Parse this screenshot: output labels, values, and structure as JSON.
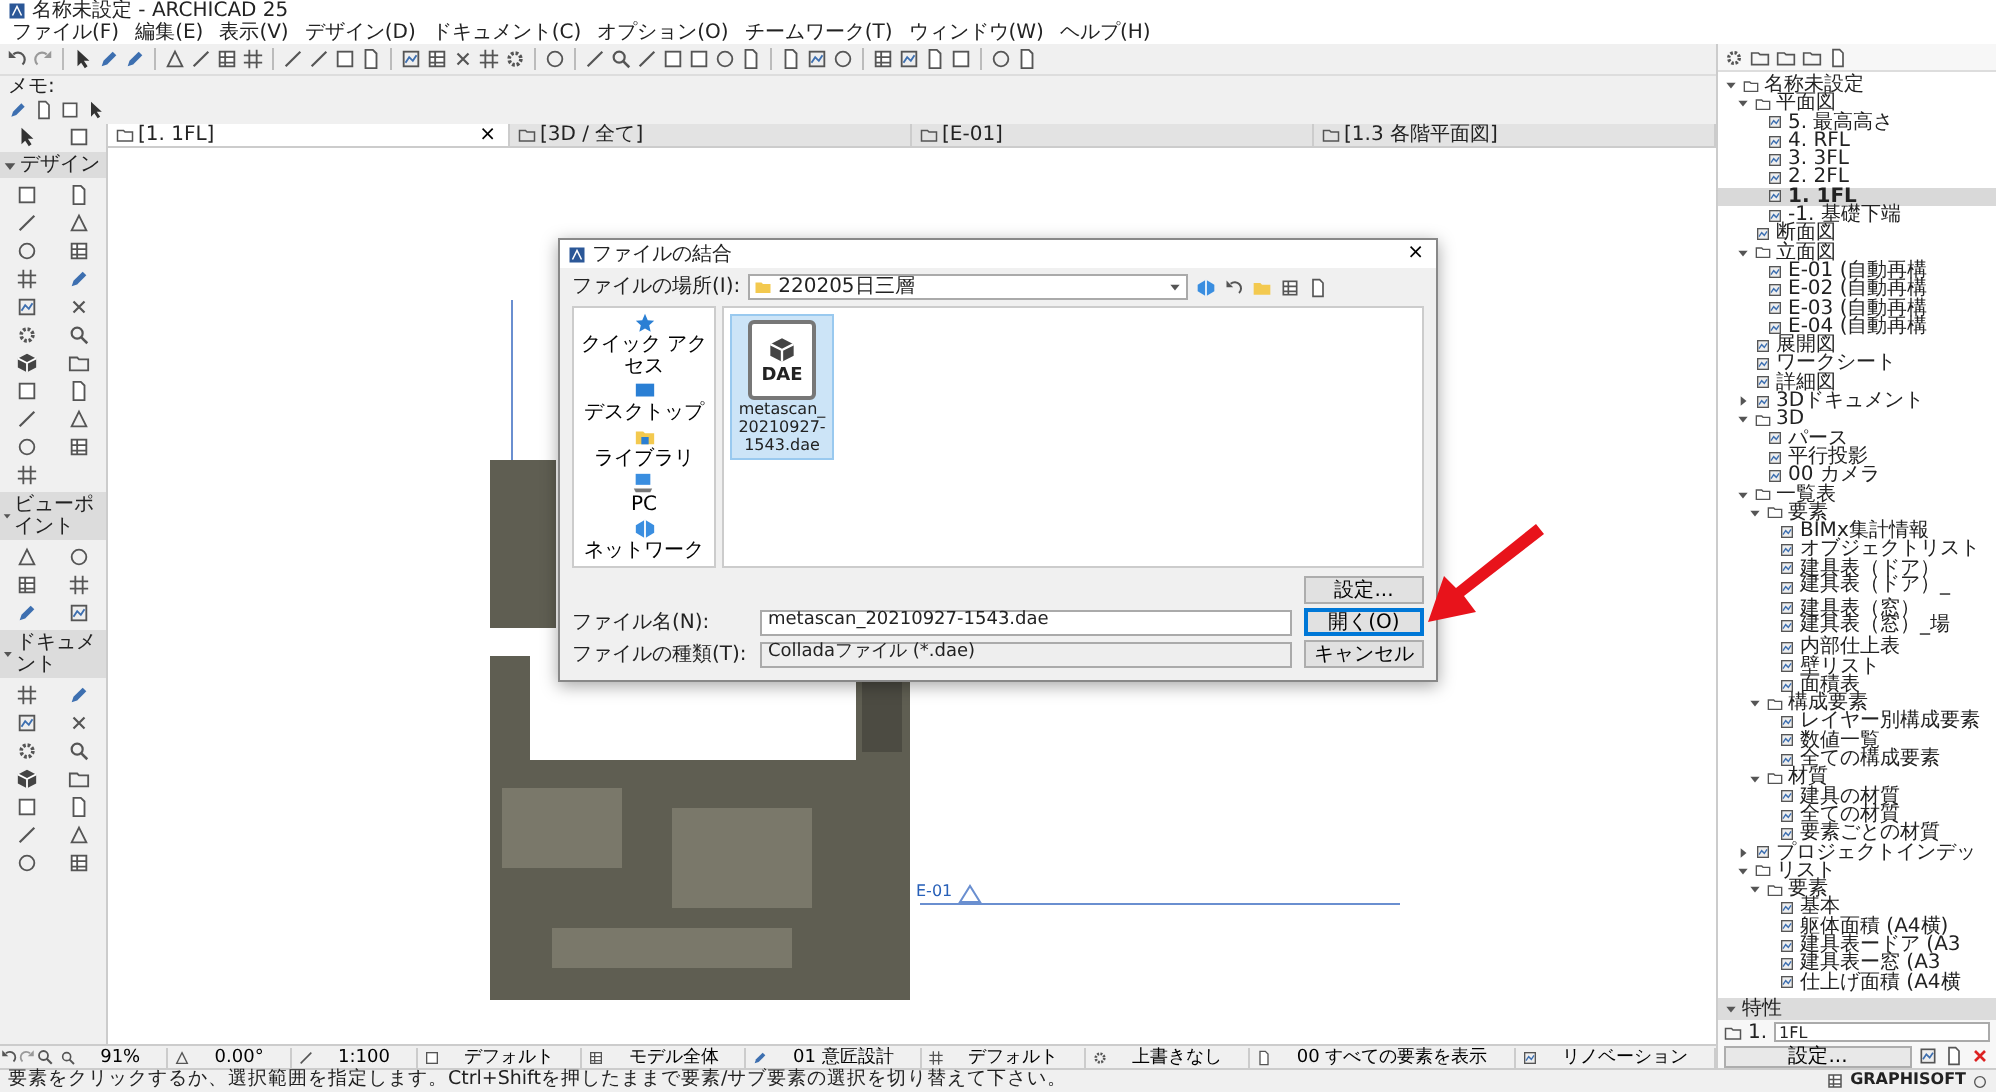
{
  "window": {
    "title": "名称未設定 - ARCHICAD 25"
  },
  "menu": [
    "ファイル(F)",
    "編集(E)",
    "表示(V)",
    "デザイン(D)",
    "ドキュメント(C)",
    "オプション(O)",
    "チームワーク(T)",
    "ウィンドウ(W)",
    "ヘルプ(H)"
  ],
  "info_box": {
    "label": "メモ:"
  },
  "tabs": [
    {
      "label": "[1. 1FL]",
      "selected": true,
      "close": "×"
    },
    {
      "label": "[3D / 全て]",
      "selected": false
    },
    {
      "label": "[E-01]",
      "selected": false
    },
    {
      "label": "[1.3 各階平面図]",
      "selected": false
    }
  ],
  "toolbox": {
    "sections": [
      {
        "title": "デザイン",
        "expanded": true
      },
      {
        "title": "ビューポイント",
        "expanded": true
      },
      {
        "title": "ドキュメント",
        "expanded": true
      }
    ]
  },
  "canvas": {
    "marker_label": "E-01"
  },
  "dialog": {
    "title": "ファイルの結合",
    "close": "×",
    "location_label": "ファイルの場所(I):",
    "location": "220205日三層",
    "places": [
      {
        "label": "クイック アクセス",
        "kind": "star"
      },
      {
        "label": "デスクトップ",
        "kind": "desktop"
      },
      {
        "label": "ライブラリ",
        "kind": "library"
      },
      {
        "label": "PC",
        "kind": "pc"
      },
      {
        "label": "ネットワーク",
        "kind": "network"
      }
    ],
    "files": [
      {
        "type_label": "DAE",
        "name": "metascan_20210927-1543.dae",
        "selected": true
      }
    ],
    "filename_label": "ファイル名(N):",
    "filename": "metascan_20210927-1543.dae",
    "filetype_label": "ファイルの種類(T):",
    "filetype": "Colladaファイル (*.dae)",
    "buttons": [
      {
        "label": "設定...",
        "default": false
      },
      {
        "label": "開く(O)",
        "default": true
      },
      {
        "label": "キャンセル",
        "default": false
      }
    ]
  },
  "navigator": {
    "tree": [
      {
        "label": "名称未設定",
        "selected": false,
        "expanded": true,
        "children": [
          {
            "label": "平面図",
            "selected": false,
            "expanded": true,
            "children": [
              {
                "label": "5. 最高高さ",
                "selected": false
              },
              {
                "label": "4. RFL",
                "selected": false
              },
              {
                "label": "3. 3FL",
                "selected": false
              },
              {
                "label": "2. 2FL",
                "selected": false
              },
              {
                "label": "1. 1FL",
                "selected": true
              },
              {
                "label": "-1. 基礎下端",
                "selected": false
              }
            ]
          },
          {
            "label": "断面図",
            "selected": false
          },
          {
            "label": "立面図",
            "selected": false,
            "expanded": true,
            "children": [
              {
                "label": "E-01 (自動再構",
                "selected": false
              },
              {
                "label": "E-02 (自動再構",
                "selected": false
              },
              {
                "label": "E-03 (自動再構",
                "selected": false
              },
              {
                "label": "E-04 (自動再構",
                "selected": false
              }
            ]
          },
          {
            "label": "展開図",
            "selected": false
          },
          {
            "label": "ワークシート",
            "selected": false
          },
          {
            "label": "詳細図",
            "selected": false
          },
          {
            "label": "3Dドキュメント",
            "selected": false,
            "expanded": false
          },
          {
            "label": "3D",
            "selected": false,
            "expanded": true,
            "children": [
              {
                "label": "パース",
                "selected": false
              },
              {
                "label": "平行投影",
                "selected": false
              },
              {
                "label": "00 カメラ",
                "selected": false
              }
            ]
          },
          {
            "label": "一覧表",
            "selected": false,
            "expanded": true,
            "children": [
              {
                "label": "要素",
                "selected": false,
                "expanded": true,
                "children": [
                  {
                    "label": "BIMx集計情報",
                    "selected": false
                  },
                  {
                    "label": "オブジェクトリスト",
                    "selected": false
                  },
                  {
                    "label": "建具表（ドア）",
                    "selected": false
                  },
                  {
                    "label": "建具表（ドア）_",
                    "selected": false
                  },
                  {
                    "label": "建具表（窓）",
                    "selected": false
                  },
                  {
                    "label": "建具表（窓）_場",
                    "selected": false
                  },
                  {
                    "label": "内部仕上表",
                    "selected": false
                  },
                  {
                    "label": "壁リスト",
                    "selected": false
                  },
                  {
                    "label": "面積表",
                    "selected": false
                  }
                ]
              },
              {
                "label": "構成要素",
                "selected": false,
                "expanded": true,
                "children": [
                  {
                    "label": "レイヤー別構成要素",
                    "selected": false
                  },
                  {
                    "label": "数値一覧",
                    "selected": false
                  },
                  {
                    "label": "全ての構成要素",
                    "selected": false
                  }
                ]
              },
              {
                "label": "材質",
                "selected": false,
                "expanded": true,
                "children": [
                  {
                    "label": "建具の材質",
                    "selected": false
                  },
                  {
                    "label": "全ての材質",
                    "selected": false
                  },
                  {
                    "label": "要素ごとの材質",
                    "selected": false
                  }
                ]
              }
            ]
          },
          {
            "label": "プロジェクトインデッ",
            "selected": false,
            "expanded": false
          },
          {
            "label": "リスト",
            "selected": false,
            "expanded": true,
            "children": [
              {
                "label": "要素",
                "selected": false,
                "expanded": true,
                "children": [
                  {
                    "label": "基本",
                    "selected": false
                  },
                  {
                    "label": "躯体面積 (A4横)",
                    "selected": false
                  },
                  {
                    "label": "建具表ードア (A3",
                    "selected": false
                  },
                  {
                    "label": "建具表ー窓 (A3",
                    "selected": false
                  },
                  {
                    "label": "仕上げ面積 (A4横",
                    "selected": false
                  }
                ]
              }
            ]
          }
        ]
      }
    ]
  },
  "properties": {
    "title": "特性",
    "expanded": true,
    "id_label": "1.",
    "id_value": "1FL",
    "settings_button": "設定..."
  },
  "bottom_bar": [
    "91%",
    "0.00°",
    "1:100",
    "デフォルト",
    "モデル全体",
    "01 意匠設計",
    "デフォルト",
    "上書きなし",
    "00 すべての要素を表示",
    "リノベーション"
  ],
  "status_bar": {
    "hint": "要素をクリックするか、選択範囲を指定します。Ctrl+Shiftを押したままで要素/サブ要素の選択を切り替えて下さい。",
    "brand": "GRAPHISOFT"
  }
}
